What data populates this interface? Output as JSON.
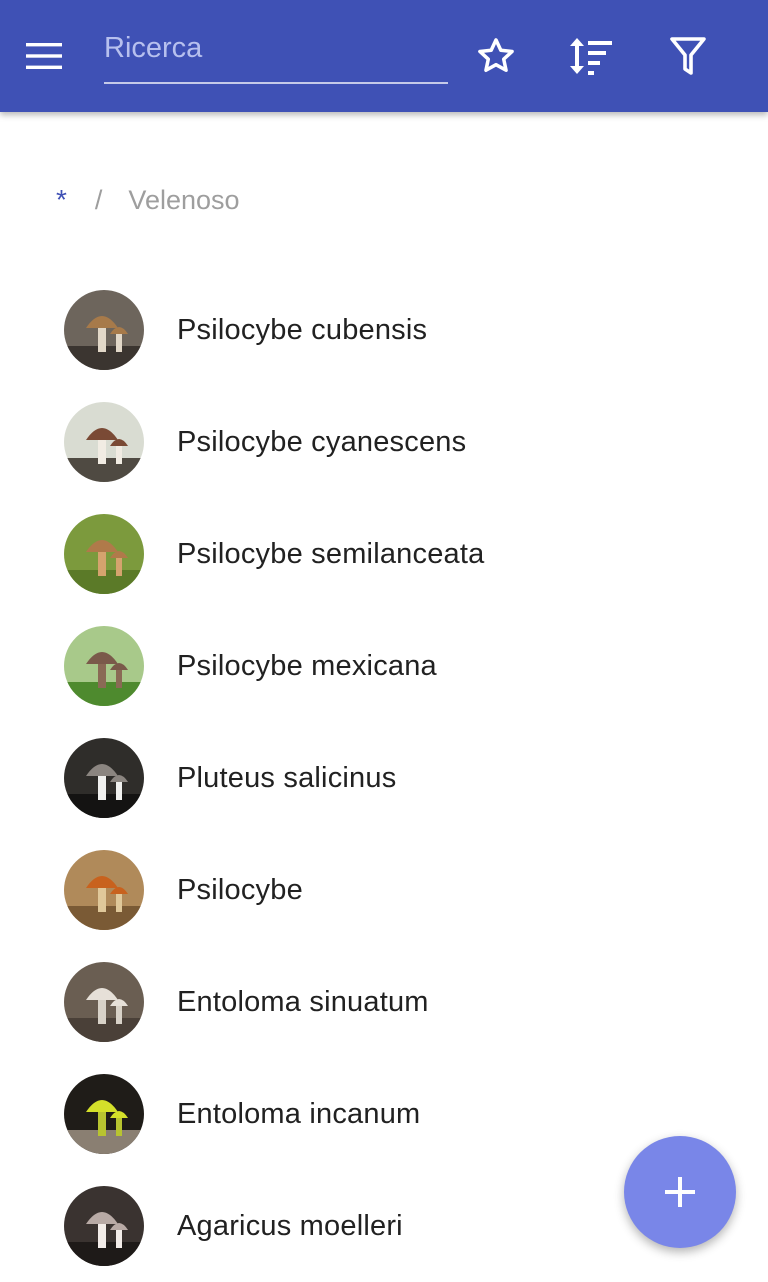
{
  "theme": {
    "primary": "#3f51b5",
    "fab": "#7986e8",
    "text": "#212121",
    "muted": "#9e9e9e"
  },
  "toolbar": {
    "menu_icon": "hamburger-menu-icon",
    "search_placeholder": "Ricerca",
    "search_value": "",
    "favorites_icon": "star-outline-icon",
    "sort_icon": "sort-icon",
    "filter_icon": "filter-icon"
  },
  "breadcrumb": {
    "root": "*",
    "separator": "/",
    "current": "Velenoso"
  },
  "mushrooms": [
    {
      "name": "Psilocybe cubensis",
      "thumb": {
        "bg": "#6d655c",
        "ground": "#3b3530",
        "cap": "#a77a4a",
        "stem": "#e2d8c8"
      }
    },
    {
      "name": "Psilocybe cyanescens",
      "thumb": {
        "bg": "#d9dcd2",
        "ground": "#4f4a42",
        "cap": "#7a4a35",
        "stem": "#f1ece3"
      }
    },
    {
      "name": "Psilocybe semilanceata",
      "thumb": {
        "bg": "#7c9a3d",
        "ground": "#5b7a28",
        "cap": "#b07a4a",
        "stem": "#d5a36e"
      }
    },
    {
      "name": "Psilocybe mexicana",
      "thumb": {
        "bg": "#a8c98a",
        "ground": "#4e8a2e",
        "cap": "#7a5a4a",
        "stem": "#8a6a55"
      }
    },
    {
      "name": "Pluteus salicinus",
      "thumb": {
        "bg": "#2f2d2a",
        "ground": "#141312",
        "cap": "#8b8580",
        "stem": "#f0f0ee"
      }
    },
    {
      "name": "Psilocybe",
      "thumb": {
        "bg": "#b08a5a",
        "ground": "#7a5a35",
        "cap": "#c8621e",
        "stem": "#e0c89a"
      }
    },
    {
      "name": "Entoloma sinuatum",
      "thumb": {
        "bg": "#6a5e52",
        "ground": "#4a4038",
        "cap": "#e6e0d8",
        "stem": "#d8d2c8"
      }
    },
    {
      "name": "Entoloma incanum",
      "thumb": {
        "bg": "#1f1c18",
        "ground": "#8a7f72",
        "cap": "#d4e02a",
        "stem": "#b8c430"
      }
    },
    {
      "name": "Agaricus moelleri",
      "thumb": {
        "bg": "#3a3330",
        "ground": "#1e1a18",
        "cap": "#b8aaa5",
        "stem": "#f2ece8"
      }
    }
  ],
  "fab": {
    "icon": "plus-icon"
  }
}
